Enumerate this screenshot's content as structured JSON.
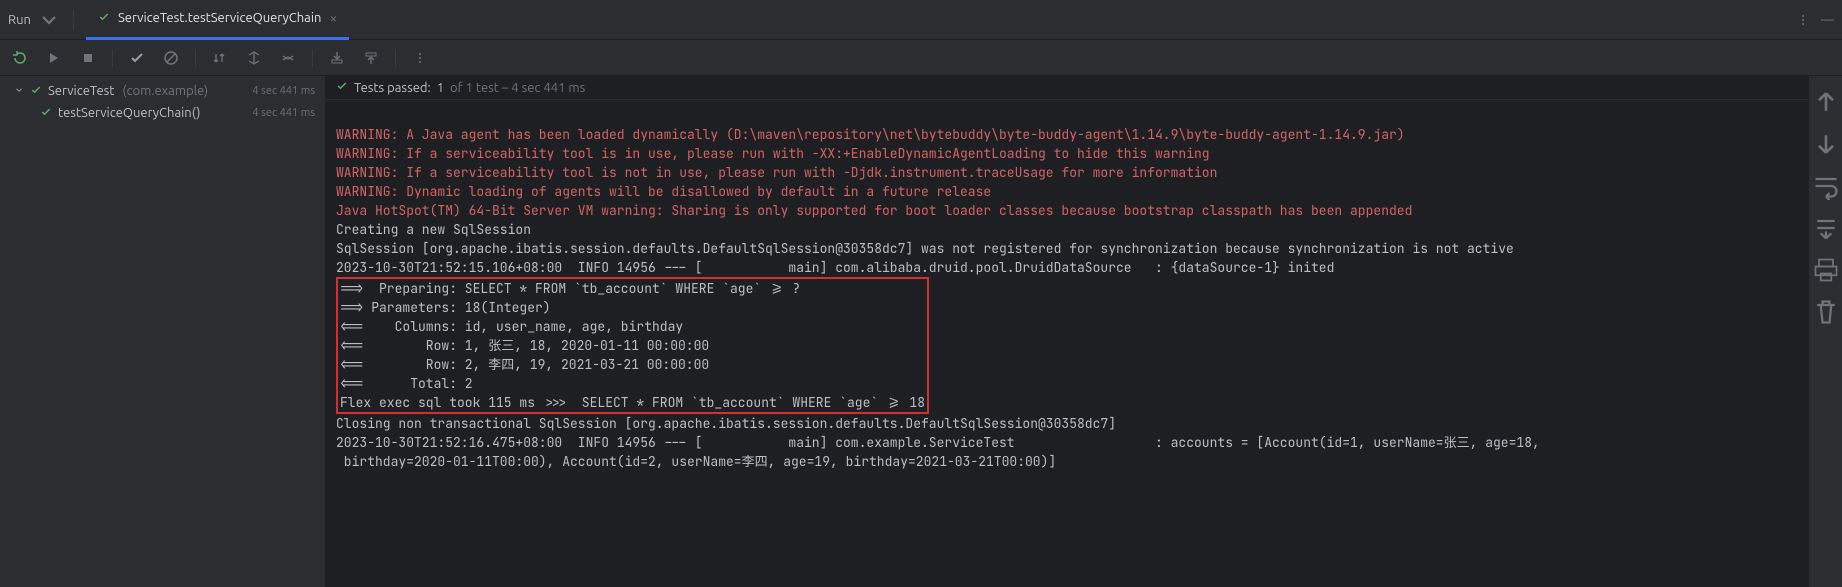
{
  "top": {
    "run_label": "Run",
    "tab_title": "ServiceTest.testServiceQueryChain"
  },
  "toolbar": {
    "rerun": "Rerun",
    "rerun_failed": "Rerun Failed Tests",
    "stop": "Stop",
    "show_passed": "Show Passed",
    "show_ignored": "Show Ignored",
    "sort": "Sort",
    "collapse": "Collapse",
    "expand": "Expand",
    "import": "Import",
    "export": "Export",
    "more": "More"
  },
  "tree": {
    "items": [
      {
        "name": "ServiceTest",
        "pkg": "(com.example)",
        "time": "4 sec 441 ms"
      },
      {
        "name": "testServiceQueryChain()",
        "pkg": "",
        "time": "4 sec 441 ms"
      }
    ]
  },
  "summary": {
    "passed_label": "Tests passed:",
    "passed_count": "1",
    "rest": " of 1 test – 4 sec 441 ms"
  },
  "console": {
    "warn_lines": [
      "WARNING: A Java agent has been loaded dynamically (D:\\maven\\repository\\net\\bytebuddy\\byte-buddy-agent\\1.14.9\\byte-buddy-agent-1.14.9.jar)",
      "WARNING: If a serviceability tool is in use, please run with -XX:+EnableDynamicAgentLoading to hide this warning",
      "WARNING: If a serviceability tool is not in use, please run with -Djdk.instrument.traceUsage for more information",
      "WARNING: Dynamic loading of agents will be disallowed by default in a future release",
      "Java HotSpot(TM) 64-Bit Server VM warning: Sharing is only supported for boot loader classes because bootstrap classpath has been appended"
    ],
    "pre_box": [
      "Creating a new SqlSession",
      "SqlSession [org.apache.ibatis.session.defaults.DefaultSqlSession@30358dc7] was not registered for synchronization because synchronization is not active",
      "2023-10-30T21:52:15.106+08:00  INFO 14956 --- [           main] com.alibaba.druid.pool.DruidDataSource   : {dataSource-1} inited"
    ],
    "box_lines": [
      "==>  Preparing: SELECT * FROM `tb_account` WHERE `age` >= ?",
      "==> Parameters: 18(Integer)",
      "<==    Columns: id, user_name, age, birthday",
      "<==        Row: 1, 张三, 18, 2020-01-11 00:00:00",
      "<==        Row: 2, 李四, 19, 2021-03-21 00:00:00",
      "<==      Total: 2",
      "Flex exec sql took 115 ms >>>  SELECT * FROM `tb_account` WHERE `age` >= 18"
    ],
    "post_box": [
      "Closing non transactional SqlSession [org.apache.ibatis.session.defaults.DefaultSqlSession@30358dc7]",
      "2023-10-30T21:52:16.475+08:00  INFO 14956 --- [           main] com.example.ServiceTest                  : accounts = [Account(id=1, userName=张三, age=18, ",
      " birthday=2020-01-11T00:00), Account(id=2, userName=李四, age=19, birthday=2021-03-21T00:00)]"
    ]
  },
  "rail": {
    "up": "Up the Stack Trace",
    "down": "Down the Stack Trace",
    "wrap": "Soft-Wrap",
    "scroll": "Scroll to End",
    "print": "Print",
    "clear": "Clear All"
  }
}
